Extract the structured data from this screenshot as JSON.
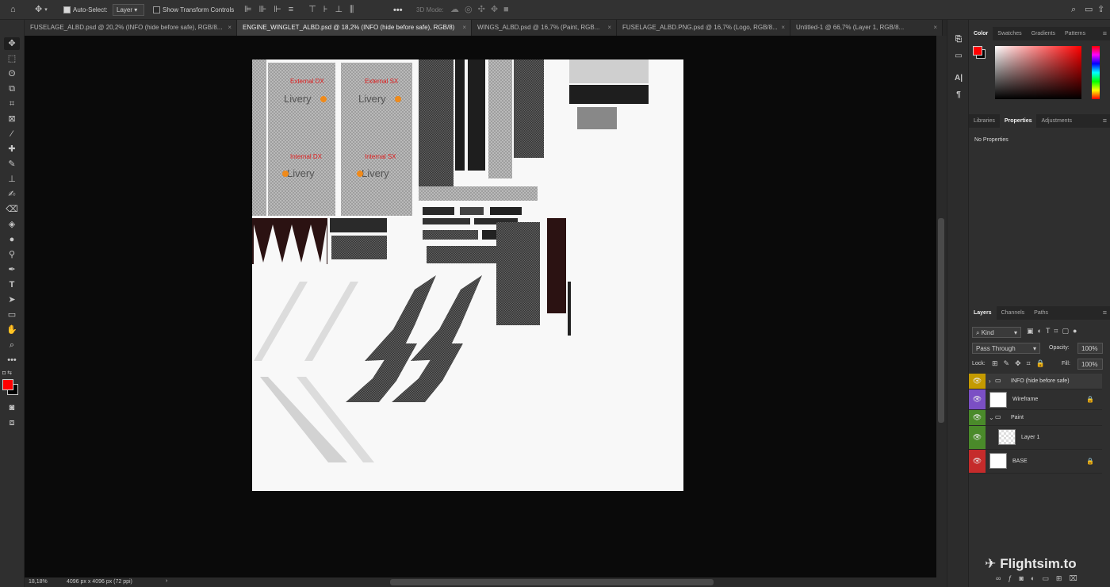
{
  "options_bar": {
    "auto_select_label": "Auto-Select:",
    "auto_select_value": "Layer",
    "show_transform_label": "Show Transform Controls",
    "mode_3d_label": "3D Mode:",
    "more_label": "•••"
  },
  "tabs": [
    {
      "label": "FUSELAGE_ALBD.psd @ 20,2% (INFO (hide before safe), RGB/8...",
      "active": false
    },
    {
      "label": "ENGINE_WINGLET_ALBD.psd @ 18,2% (INFO (hide before safe), RGB/8)",
      "active": true
    },
    {
      "label": "WINGS_ALBD.psd @ 16,7% (Paint, RGB...",
      "active": false
    },
    {
      "label": "FUSELAGE_ALBD.PNG.psd @ 16,7% (Logo, RGB/8...",
      "active": false
    },
    {
      "label": "Untitled-1 @ 66,7% (Layer 1, RGB/8...",
      "active": false
    }
  ],
  "tab_close_glyph": "×",
  "status": {
    "zoom": "18,18%",
    "doc_info": "4096 px x 4096 px (72 ppi)",
    "arrow": "›"
  },
  "canvas_labels": {
    "external_dx": "External DX",
    "external_sx": "External SX",
    "internal_dx": "Internal DX",
    "internal_sx": "Internal SX",
    "logo": "Livery"
  },
  "color_panel": {
    "tabs": [
      "Color",
      "Swatches",
      "Gradients",
      "Patterns"
    ],
    "foreground": "#ff0000",
    "background": "#000000"
  },
  "properties_panel": {
    "tabs": [
      "Libraries",
      "Properties",
      "Adjustments"
    ],
    "empty_text": "No Properties"
  },
  "layers_panel": {
    "tabs": [
      "Layers",
      "Channels",
      "Paths"
    ],
    "filter_kind": "Kind",
    "blend_mode": "Pass Through",
    "opacity_label": "Opacity:",
    "opacity_value": "100%",
    "lock_label": "Lock:",
    "fill_label": "Fill:",
    "fill_value": "100%",
    "layers": [
      {
        "name": "INFO (hide before safe)",
        "type": "group",
        "color": "#c49a00",
        "locked": false
      },
      {
        "name": "Wireframe",
        "type": "layer",
        "color": "#7b4fc4",
        "locked": true
      },
      {
        "name": "Paint",
        "type": "group",
        "color": "#4a8a2a",
        "locked": false
      },
      {
        "name": "Layer 1",
        "type": "layer",
        "color": "#4a8a2a",
        "locked": false
      },
      {
        "name": "BASE",
        "type": "layer",
        "color": "#c52b2b",
        "locked": true
      }
    ],
    "footer_icons": [
      "link-icon",
      "fx-icon",
      "mask-icon",
      "adjustment-icon",
      "group-icon",
      "new-layer-icon",
      "trash-icon"
    ]
  },
  "watermark": "Flightsim.to"
}
